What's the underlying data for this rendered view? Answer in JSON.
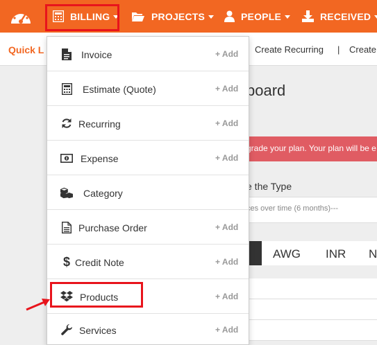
{
  "nav": {
    "logo_icon": "dashboard-gauge-icon",
    "items": [
      {
        "label": "BILLING",
        "icon": "calculator-icon"
      },
      {
        "label": "PROJECTS",
        "icon": "folder-open-icon"
      },
      {
        "label": "PEOPLE",
        "icon": "user-icon"
      },
      {
        "label": "RECEIVED",
        "icon": "download-icon"
      }
    ]
  },
  "quick_links": {
    "title": "Quick L",
    "links": [
      "Create Recurring",
      "|",
      "Create"
    ]
  },
  "main": {
    "title": "board",
    "alert_text": "grade your plan. Your plan will be e",
    "type_text": "e the Type",
    "panel_note": "ces over time (6 months)---",
    "currency_tabs": [
      "AWG",
      "INR",
      "N"
    ]
  },
  "billing_menu": {
    "items": [
      {
        "label": "Invoice",
        "icon": "file-text-icon",
        "add": "+ Add"
      },
      {
        "label": "Estimate (Quote)",
        "icon": "calculator-icon",
        "add": "+ Add"
      },
      {
        "label": "Recurring",
        "icon": "refresh-icon",
        "add": "+ Add"
      },
      {
        "label": "Expense",
        "icon": "money-bill-icon",
        "add": "+ Add"
      },
      {
        "label": "Category",
        "icon": "cubes-icon",
        "add": ""
      },
      {
        "label": "Purchase Order",
        "icon": "file-list-icon",
        "add": "+ Add"
      },
      {
        "label": "Credit Note",
        "icon": "dollar-icon",
        "add": "+ Add"
      },
      {
        "label": "Products",
        "icon": "dropbox-icon",
        "add": "+ Add"
      },
      {
        "label": "Services",
        "icon": "wrench-icon",
        "add": "+ Add"
      }
    ]
  },
  "colors": {
    "nav_bg": "#f26722",
    "highlight_red": "#e8141c",
    "alert_bg": "#e05c63"
  }
}
